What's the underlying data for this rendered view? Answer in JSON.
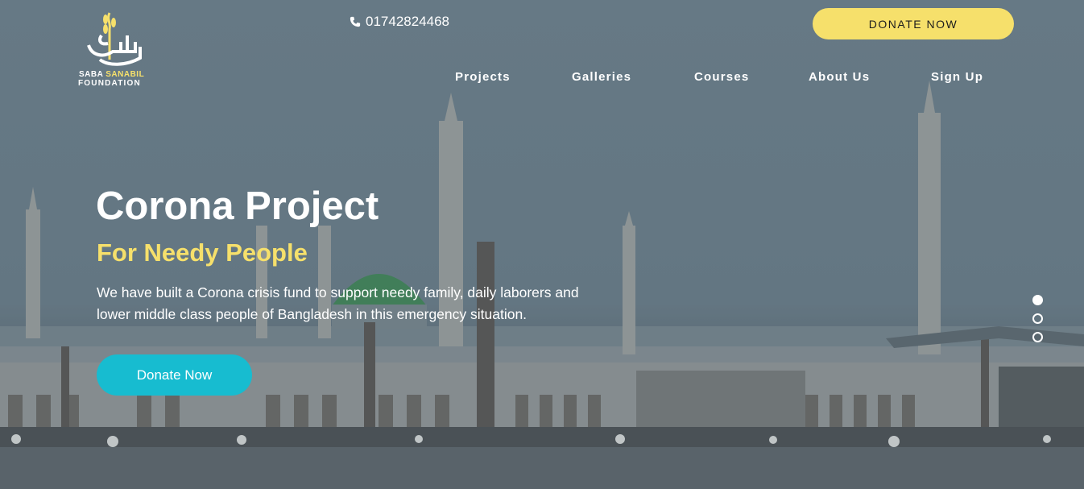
{
  "brand": {
    "name_part1": "SABA",
    "name_part2": "SANABIL",
    "name_part3": "FOUNDATION",
    "accent_color": "#f6e06b",
    "logo_icon": "wheat-calligraphy-logo"
  },
  "header": {
    "phone_icon": "phone-icon",
    "phone": "01742824468",
    "donate_label": "DONATE NOW"
  },
  "nav": {
    "items": [
      {
        "label": "Projects"
      },
      {
        "label": "Galleries"
      },
      {
        "label": "Courses"
      },
      {
        "label": "About Us"
      },
      {
        "label": "Sign Up"
      }
    ]
  },
  "hero": {
    "title": "Corona Project",
    "subtitle": "For Needy People",
    "description": "We have built a Corona crisis fund to support needy family, daily laborers and lower middle class people of Bangladesh in this emergency situation.",
    "cta_label": "Donate Now",
    "cta_color": "#17bcd0",
    "background_scene": "mosque-courtyard-photo"
  },
  "carousel": {
    "slide_count": 3,
    "active_index": 0
  }
}
